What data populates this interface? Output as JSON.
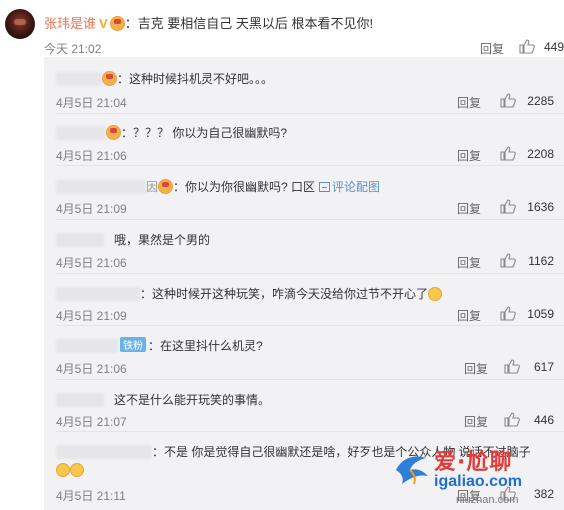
{
  "main_comment": {
    "username": "张玮是谁",
    "verified_icon": "v-badge-icon",
    "text": "：吉克 要相信自己 天黑以后 根本看不见你!",
    "time": "今天 21:02",
    "reply_label": "回复",
    "likes": "449"
  },
  "replies": [
    {
      "text": "：这种时候抖机灵不好吧。。。",
      "time": "4月5日 21:04",
      "reply_label": "回复",
      "likes": "2285"
    },
    {
      "text": "：？？？ 你以为自己很幽默吗?",
      "time": "4月5日 21:06",
      "reply_label": "回复",
      "likes": "2208"
    },
    {
      "name_tail": "因",
      "text": "：你以为你很幽默吗? 口区",
      "pic_link": "评论配图",
      "time": "4月5日 21:09",
      "reply_label": "回复",
      "likes": "1636"
    },
    {
      "text": "哦，果然是个男的",
      "time": "4月5日 21:06",
      "reply_label": "回复",
      "likes": "1162"
    },
    {
      "text": "：这种时候开这种玩笑，咋滴今天没给你过节不开心了",
      "time": "4月5日 21:09",
      "reply_label": "回复",
      "likes": "1059"
    },
    {
      "badge": "铁粉",
      "text": "：在这里抖什么机灵?",
      "time": "4月5日 21:06",
      "reply_label": "回复",
      "likes": "617"
    },
    {
      "text": "这不是什么能开玩笑的事情。",
      "time": "4月5日 21:07",
      "reply_label": "回复",
      "likes": "446"
    },
    {
      "text": "：不是 你是觉得自己很幽默还是啥，好歹也是个公众人物 说话不过脑子",
      "time": "4月5日 21:11",
      "reply_label": "回复",
      "likes": "382"
    }
  ],
  "watermark": {
    "title": "爱·尬聊",
    "url": "igaliao.com",
    "sub": "niuzhan.com"
  },
  "colors": {
    "username": "#eb7350",
    "reply_bg": "#f2f2f5",
    "link": "#5d8fc6",
    "muted": "#808080"
  }
}
